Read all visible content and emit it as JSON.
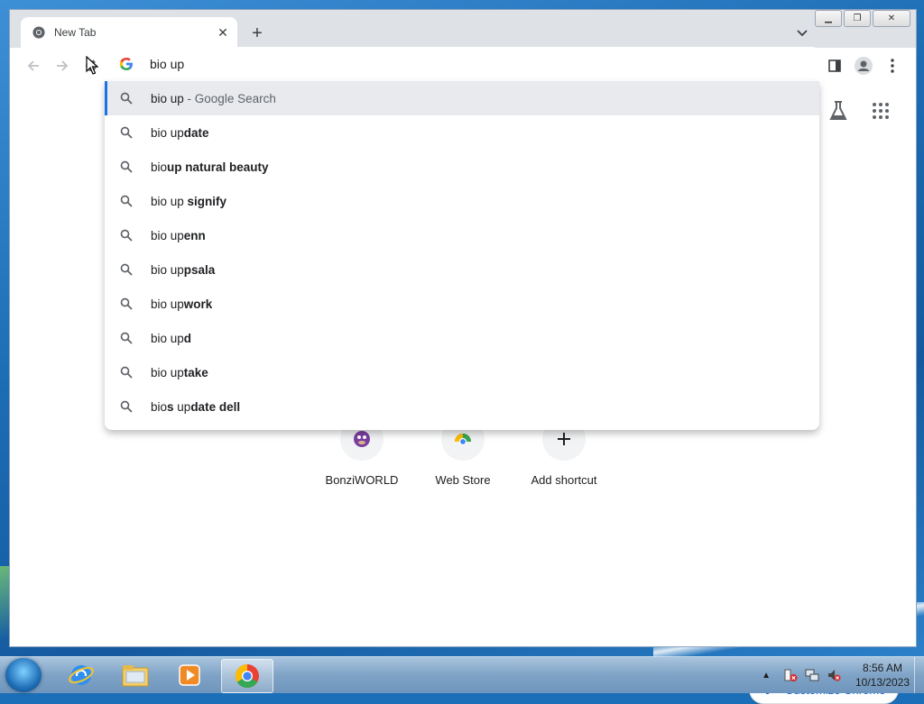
{
  "browser": {
    "tab_title": "New Tab",
    "omnibox_value": "bio up"
  },
  "suggestions": [
    {
      "plain": "bio up",
      "bold": "",
      "desc": " - Google Search",
      "selected": true
    },
    {
      "plain": "bio up",
      "bold": "date",
      "desc": ""
    },
    {
      "plain": "bio",
      "bold": "up natural beauty",
      "desc": ""
    },
    {
      "plain": "bio up ",
      "bold": "signify",
      "desc": ""
    },
    {
      "plain": "bio up",
      "bold": "enn",
      "desc": ""
    },
    {
      "plain": "bio up",
      "bold": "psala",
      "desc": ""
    },
    {
      "plain": "bio up",
      "bold": "work",
      "desc": ""
    },
    {
      "plain": "bio up",
      "bold": "d",
      "desc": ""
    },
    {
      "plain": "bio up",
      "bold": "take",
      "desc": ""
    },
    {
      "plain": "bio",
      "bold": "s",
      "plain2": " up",
      "bold2": "date dell",
      "desc": ""
    }
  ],
  "shortcuts": [
    {
      "label": "BonziWORLD",
      "icon": "bonzi-icon"
    },
    {
      "label": "Web Store",
      "icon": "web-store-icon"
    },
    {
      "label": "Add shortcut",
      "icon": "plus-icon"
    }
  ],
  "customize_label": "Customize Chrome",
  "taskbar": {
    "time": "8:56 AM",
    "date": "10/13/2023"
  },
  "colors": {
    "accent": "#1a73e8",
    "customize_text": "#1967d2"
  }
}
